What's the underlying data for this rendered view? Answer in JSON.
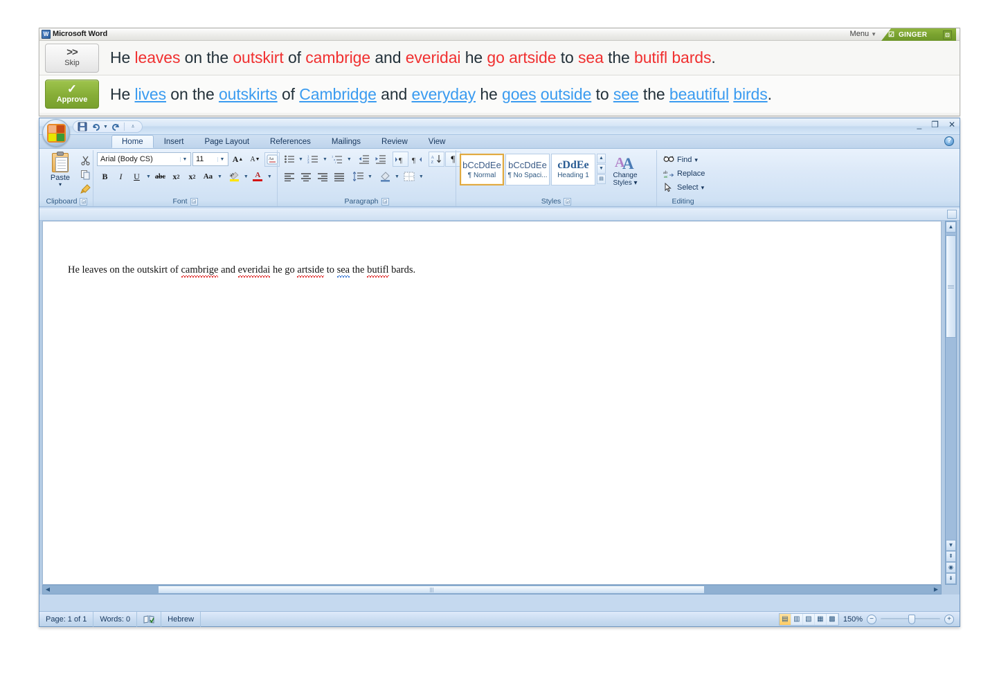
{
  "ginger": {
    "window_title": "Microsoft Word",
    "menu_label": "Menu",
    "brand_label": "GINGER",
    "brand_check": "☑",
    "minimize_glyph": "⊡",
    "skip_button": {
      "glyph": ">>",
      "label": "Skip"
    },
    "approve_button": {
      "glyph": "✓",
      "label": "Approve"
    },
    "original_sentence": [
      {
        "t": "He ",
        "k": "plain"
      },
      {
        "t": "leaves",
        "k": "error"
      },
      {
        "t": " on the ",
        "k": "plain"
      },
      {
        "t": "outskirt",
        "k": "error"
      },
      {
        "t": " of ",
        "k": "plain"
      },
      {
        "t": "cambrige",
        "k": "error"
      },
      {
        "t": " and ",
        "k": "plain"
      },
      {
        "t": "everidai",
        "k": "error"
      },
      {
        "t": " he ",
        "k": "plain"
      },
      {
        "t": "go artside",
        "k": "error"
      },
      {
        "t": " to ",
        "k": "plain"
      },
      {
        "t": "sea",
        "k": "error"
      },
      {
        "t": " the ",
        "k": "plain"
      },
      {
        "t": "butifl bards",
        "k": "error"
      },
      {
        "t": ".",
        "k": "plain"
      }
    ],
    "corrected_sentence": [
      {
        "t": "He ",
        "k": "plain"
      },
      {
        "t": "lives",
        "k": "fix"
      },
      {
        "t": " on the ",
        "k": "plain"
      },
      {
        "t": "outskirts",
        "k": "fix"
      },
      {
        "t": " of ",
        "k": "plain"
      },
      {
        "t": "Cambridge",
        "k": "fix"
      },
      {
        "t": " and ",
        "k": "plain"
      },
      {
        "t": "everyday",
        "k": "fix"
      },
      {
        "t": " he ",
        "k": "plain"
      },
      {
        "t": "goes",
        "k": "fix"
      },
      {
        "t": " ",
        "k": "plain"
      },
      {
        "t": "outside",
        "k": "fix"
      },
      {
        "t": " to ",
        "k": "plain"
      },
      {
        "t": "see",
        "k": "fix"
      },
      {
        "t": " the ",
        "k": "plain"
      },
      {
        "t": "beautiful",
        "k": "fix"
      },
      {
        "t": " ",
        "k": "plain"
      },
      {
        "t": "birds",
        "k": "fix"
      },
      {
        "t": ".",
        "k": "plain"
      }
    ]
  },
  "word": {
    "quick_access": [
      {
        "name": "save-icon",
        "glyph": "💾"
      },
      {
        "name": "undo-icon",
        "glyph": "↺"
      },
      {
        "name": "redo-icon",
        "glyph": "↻"
      },
      {
        "name": "customize-qat-icon",
        "glyph": "▾"
      }
    ],
    "window_controls": {
      "minimize": "_",
      "restore": "❐",
      "close": "✕",
      "help": "?"
    },
    "tabs": [
      {
        "label": "Home",
        "active": true
      },
      {
        "label": "Insert",
        "active": false
      },
      {
        "label": "Page Layout",
        "active": false
      },
      {
        "label": "References",
        "active": false
      },
      {
        "label": "Mailings",
        "active": false
      },
      {
        "label": "Review",
        "active": false
      },
      {
        "label": "View",
        "active": false
      }
    ],
    "ribbon": {
      "clipboard": {
        "label": "Clipboard",
        "paste_label": "Paste",
        "paste_caret": "▾",
        "cut_glyph": "✂",
        "copy_glyph": "⧉",
        "format_painter_glyph": "🖌"
      },
      "font": {
        "label": "Font",
        "font_name": "Arial (Body CS)",
        "font_size": "11",
        "grow_font": "A",
        "shrink_font": "A",
        "clear_formatting": "Aa",
        "bold": "B",
        "italic": "I",
        "underline": "U",
        "strikethrough": "abc",
        "subscript": "x₂",
        "superscript": "x²",
        "change_case": "Aa",
        "highlight": "ab",
        "font_color": "A"
      },
      "paragraph": {
        "label": "Paragraph",
        "bullets": "≡",
        "numbering": "≡",
        "multilevel": "≡",
        "decrease_indent": "⇥",
        "increase_indent": "⇤",
        "ltr": "▶¶",
        "rtl": "¶◀",
        "sort": "A↓",
        "show_marks": "¶",
        "align_left": "≡",
        "align_center": "≡",
        "align_right": "≡",
        "justify": "≡",
        "line_spacing": "↕≡",
        "shading": "▨",
        "borders": "⊞"
      },
      "styles": {
        "label": "Styles",
        "gallery": [
          {
            "preview": "bCcDdEe",
            "name": "¶ Normal",
            "selected": true,
            "kind": "normal"
          },
          {
            "preview": "bCcDdEe",
            "name": "¶ No Spaci...",
            "selected": false,
            "kind": "normal"
          },
          {
            "preview": "cDdEe",
            "name": "Heading 1",
            "selected": false,
            "kind": "heading"
          }
        ],
        "change_styles_line1": "Change",
        "change_styles_line2": "Styles ▾"
      },
      "editing": {
        "label": "Editing",
        "find": "Find",
        "find_caret": "▾",
        "replace": "Replace",
        "select": "Select",
        "select_caret": "▾"
      }
    },
    "document": {
      "text_runs": [
        {
          "t": "He leaves on the outskirt of ",
          "mark": "none"
        },
        {
          "t": "cambrige",
          "mark": "red"
        },
        {
          "t": " and ",
          "mark": "none"
        },
        {
          "t": "everidai",
          "mark": "red"
        },
        {
          "t": " he go ",
          "mark": "none"
        },
        {
          "t": "artside",
          "mark": "red"
        },
        {
          "t": " to ",
          "mark": "none"
        },
        {
          "t": "sea",
          "mark": "blue"
        },
        {
          "t": " the ",
          "mark": "none"
        },
        {
          "t": "butifl",
          "mark": "red"
        },
        {
          "t": " bards.",
          "mark": "none"
        }
      ]
    },
    "status_bar": {
      "page": "Page: 1 of 1",
      "words": "Words: 0",
      "proofing_icon": "proofing-icon",
      "language": "Hebrew",
      "view_buttons": [
        {
          "name": "print-layout",
          "glyph": "▤",
          "active": true
        },
        {
          "name": "full-screen-reading",
          "glyph": "▥",
          "active": false
        },
        {
          "name": "web-layout",
          "glyph": "▧",
          "active": false
        },
        {
          "name": "outline",
          "glyph": "▦",
          "active": false
        },
        {
          "name": "draft",
          "glyph": "▩",
          "active": false
        }
      ],
      "zoom_level": "150%",
      "zoom_out": "−",
      "zoom_in": "+"
    },
    "scroll": {
      "up_arrow": "▲",
      "down_arrow": "▼",
      "left_arrow": "◀",
      "right_arrow": "▶",
      "prev_page": "⇞",
      "browse_object": "◉",
      "next_page": "⇟"
    }
  }
}
